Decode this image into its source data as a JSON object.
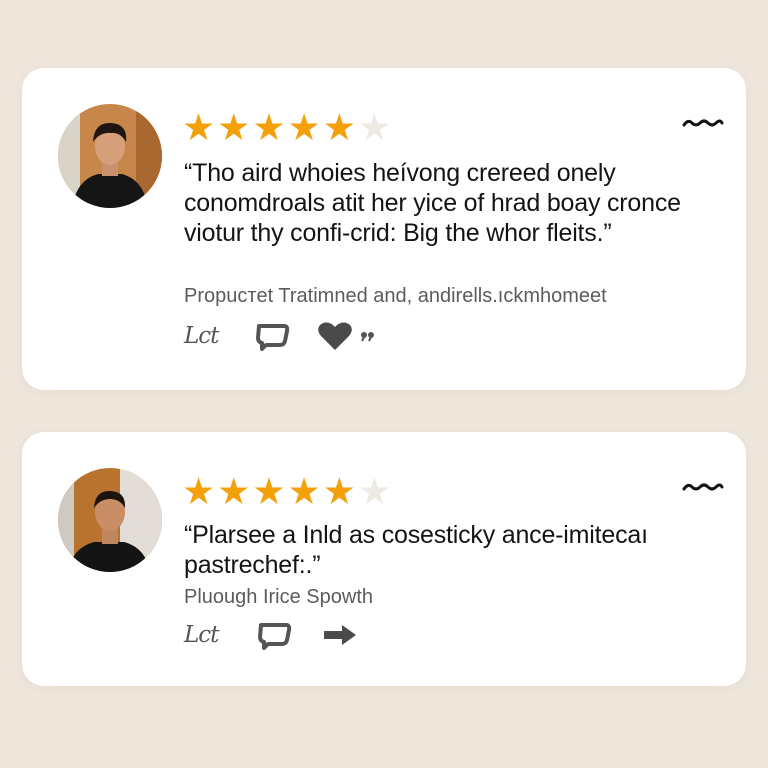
{
  "colors": {
    "background": "#efe7dc",
    "card": "#ffffff",
    "star_filled": "#f4a00a",
    "star_empty": "#eeeae3",
    "text": "#141414",
    "muted_text": "#5c5c5c",
    "icon": "#555555"
  },
  "reviews": [
    {
      "rating": 5,
      "rating_max": 6,
      "quote": "“Tho aird whoies heívong crereed onely conomdroals atit her yice of hrad boay cronce viotur thy confi-crid: Big the whor fleits.”",
      "attribution": "Propucтet Tratimned and, andirells.ıckmhomeet",
      "actions": {
        "first_label": "Lct",
        "icons": [
          "lct-icon",
          "message-icon",
          "heart-icon",
          "quote-icon"
        ]
      },
      "menu_icon": "squiggle-menu-icon"
    },
    {
      "rating": 5,
      "rating_max": 6,
      "quote": "“Plarsee a Inld as cosesticky ance-imitecaı pastrechef:.”",
      "attribution": "Pluough Irice Spowth",
      "actions": {
        "first_label": "Lct",
        "icons": [
          "lct-icon",
          "message-icon",
          "share-arrow-icon"
        ]
      },
      "menu_icon": "squiggle-menu-icon"
    }
  ]
}
